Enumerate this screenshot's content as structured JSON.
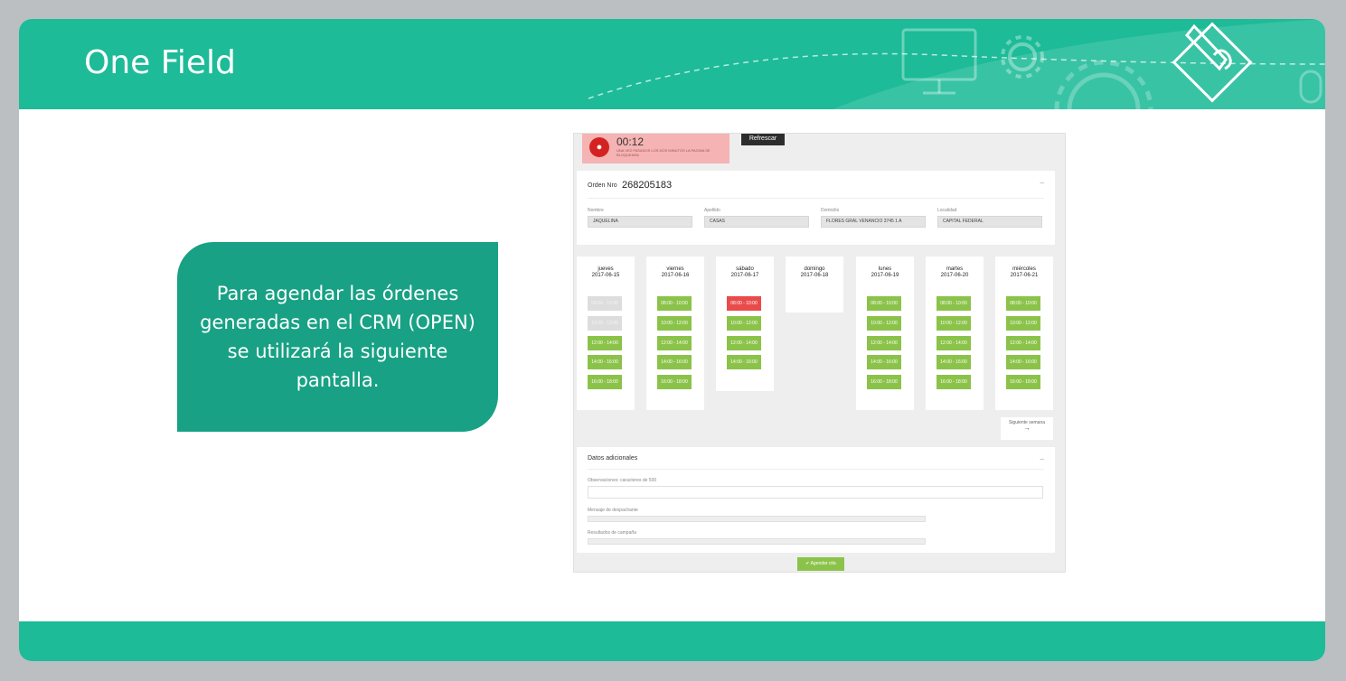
{
  "banner": {
    "title": "One Field"
  },
  "callout": {
    "text": "Para agendar las órdenes generadas en el CRM (OPEN) se utilizará la siguiente pantalla."
  },
  "screenshot": {
    "timer": {
      "time": "00:12",
      "message": "UNA VEZ PASADOS LOS DOS MINUTOS LA PAGINA SE BLOQUEARA",
      "icon": "lightbulb-icon"
    },
    "refresh_label": "Refrescar",
    "order": {
      "label": "Orden Nro",
      "number": "268205183"
    },
    "fields": [
      {
        "label": "Nombre",
        "value": "JAQUELINA"
      },
      {
        "label": "Apellido",
        "value": "CASAS"
      },
      {
        "label": "Domicilio",
        "value": "FLORES GRAL VENANCIO 3745 1 A"
      },
      {
        "label": "Localidad",
        "value": "CAPITAL FEDERAL"
      }
    ],
    "days": [
      {
        "name": "jueves",
        "date": "2017-06-15",
        "slots": [
          {
            "time": "08:00 - 10:00",
            "state": "gray"
          },
          {
            "time": "10:00 - 12:00",
            "state": "gray"
          },
          {
            "time": "12:00 - 14:00",
            "state": "green"
          },
          {
            "time": "14:00 - 16:00",
            "state": "green"
          },
          {
            "time": "16:00 - 18:00",
            "state": "green"
          }
        ]
      },
      {
        "name": "viernes",
        "date": "2017-06-16",
        "slots": [
          {
            "time": "08:00 - 10:00",
            "state": "green"
          },
          {
            "time": "10:00 - 12:00",
            "state": "green"
          },
          {
            "time": "12:00 - 14:00",
            "state": "green"
          },
          {
            "time": "14:00 - 16:00",
            "state": "green"
          },
          {
            "time": "16:00 - 18:00",
            "state": "green"
          }
        ]
      },
      {
        "name": "sábado",
        "date": "2017-06-17",
        "slots": [
          {
            "time": "08:00 - 10:00",
            "state": "red"
          },
          {
            "time": "10:00 - 12:00",
            "state": "green"
          },
          {
            "time": "12:00 - 14:00",
            "state": "green"
          },
          {
            "time": "14:00 - 16:00",
            "state": "green"
          }
        ]
      },
      {
        "name": "domingo",
        "date": "2017-06-18",
        "slots": []
      },
      {
        "name": "lunes",
        "date": "2017-06-19",
        "slots": [
          {
            "time": "08:00 - 10:00",
            "state": "green"
          },
          {
            "time": "10:00 - 12:00",
            "state": "green"
          },
          {
            "time": "12:00 - 14:00",
            "state": "green"
          },
          {
            "time": "14:00 - 16:00",
            "state": "green"
          },
          {
            "time": "16:00 - 18:00",
            "state": "green"
          }
        ]
      },
      {
        "name": "martes",
        "date": "2017-06-20",
        "slots": [
          {
            "time": "08:00 - 10:00",
            "state": "green"
          },
          {
            "time": "10:00 - 12:00",
            "state": "green"
          },
          {
            "time": "12:00 - 14:00",
            "state": "green"
          },
          {
            "time": "14:00 - 16:00",
            "state": "green"
          },
          {
            "time": "16:00 - 18:00",
            "state": "green"
          }
        ]
      },
      {
        "name": "miércoles",
        "date": "2017-06-21",
        "slots": [
          {
            "time": "08:00 - 10:00",
            "state": "green"
          },
          {
            "time": "10:00 - 12:00",
            "state": "green"
          },
          {
            "time": "12:00 - 14:00",
            "state": "green"
          },
          {
            "time": "14:00 - 16:00",
            "state": "green"
          },
          {
            "time": "16:00 - 18:00",
            "state": "green"
          }
        ]
      }
    ],
    "next_week": {
      "label": "Siguiente semana",
      "arrow": "→"
    },
    "extra": {
      "title": "Datos adicionales",
      "observaciones_label": "Observaciones: caracteres de 500",
      "despachante_label": "Mensaje de despachante",
      "campania_label": "Resultados de campaña"
    },
    "submit_label": "✔ Agendar cita"
  },
  "colors": {
    "brand": "#1dbb98",
    "callout": "#18a184",
    "slot_available": "#8bc34a",
    "slot_taken": "#e94b4b",
    "slot_disabled": "#dddddd"
  }
}
